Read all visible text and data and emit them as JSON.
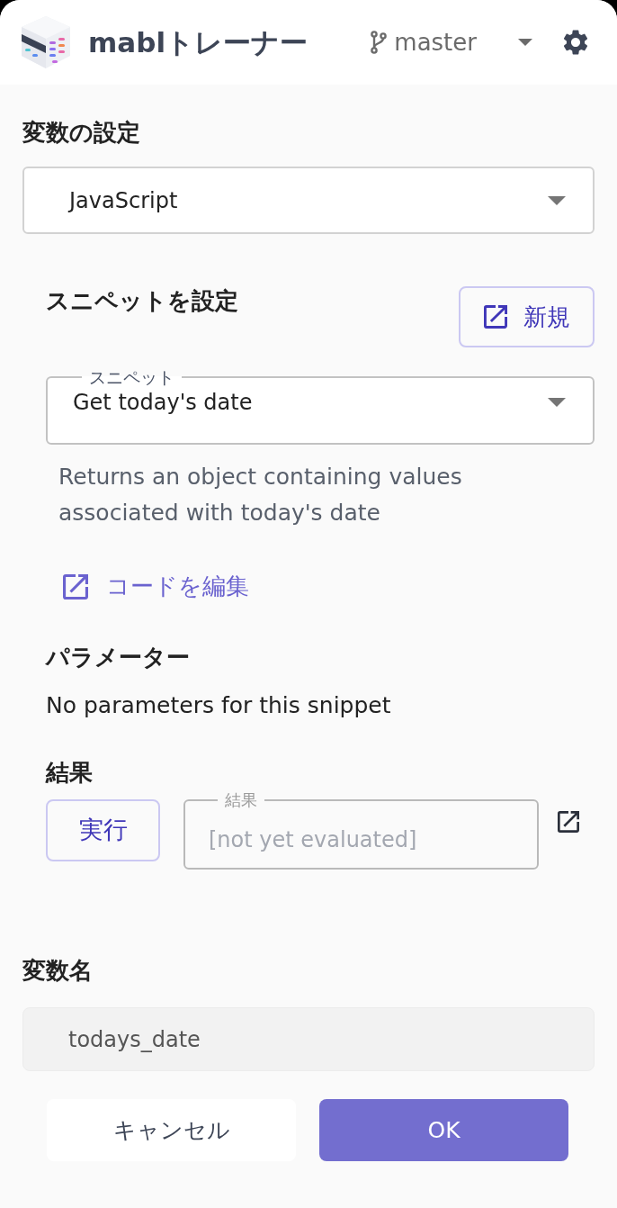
{
  "header": {
    "title": "mablトレーナー",
    "branch": "master"
  },
  "section_title": "変数の設定",
  "variable_type": {
    "value": "JavaScript"
  },
  "snippet_section": {
    "title": "スニペットを設定",
    "new_button": "新規",
    "snippet_field": {
      "label": "スニペット",
      "value": "Get today's date"
    },
    "description": "Returns an object containing values associated with today's date",
    "edit_code_link": "コードを編集"
  },
  "parameters": {
    "title": "パラメーター",
    "empty_text": "No parameters for this snippet"
  },
  "result": {
    "title": "結果",
    "run_button": "実行",
    "result_field": {
      "label": "結果",
      "placeholder": "[not yet evaluated]"
    }
  },
  "variable_name": {
    "title": "変数名",
    "value": "todays_date",
    "disabled": true
  },
  "buttons": [
    {
      "label": "キャンセル",
      "kind": "secondary"
    },
    {
      "label": "OK",
      "kind": "primary"
    }
  ]
}
